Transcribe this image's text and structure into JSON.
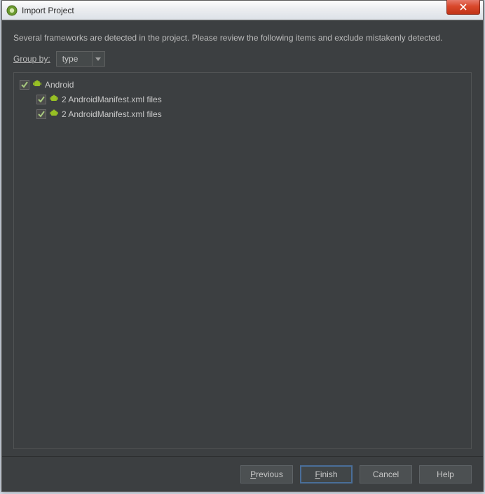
{
  "window": {
    "title": "Import Project"
  },
  "description": "Several frameworks are detected in the project. Please review the following items and exclude mistakenly detected.",
  "group_by": {
    "label": "Group by:",
    "value": "type"
  },
  "tree": {
    "root": {
      "checked": true,
      "label": "Android",
      "children": [
        {
          "checked": true,
          "label": "2 AndroidManifest.xml files"
        },
        {
          "checked": true,
          "label": "2 AndroidManifest.xml files"
        }
      ]
    }
  },
  "buttons": {
    "previous": "Previous",
    "finish": "Finish",
    "cancel": "Cancel",
    "help": "Help"
  }
}
